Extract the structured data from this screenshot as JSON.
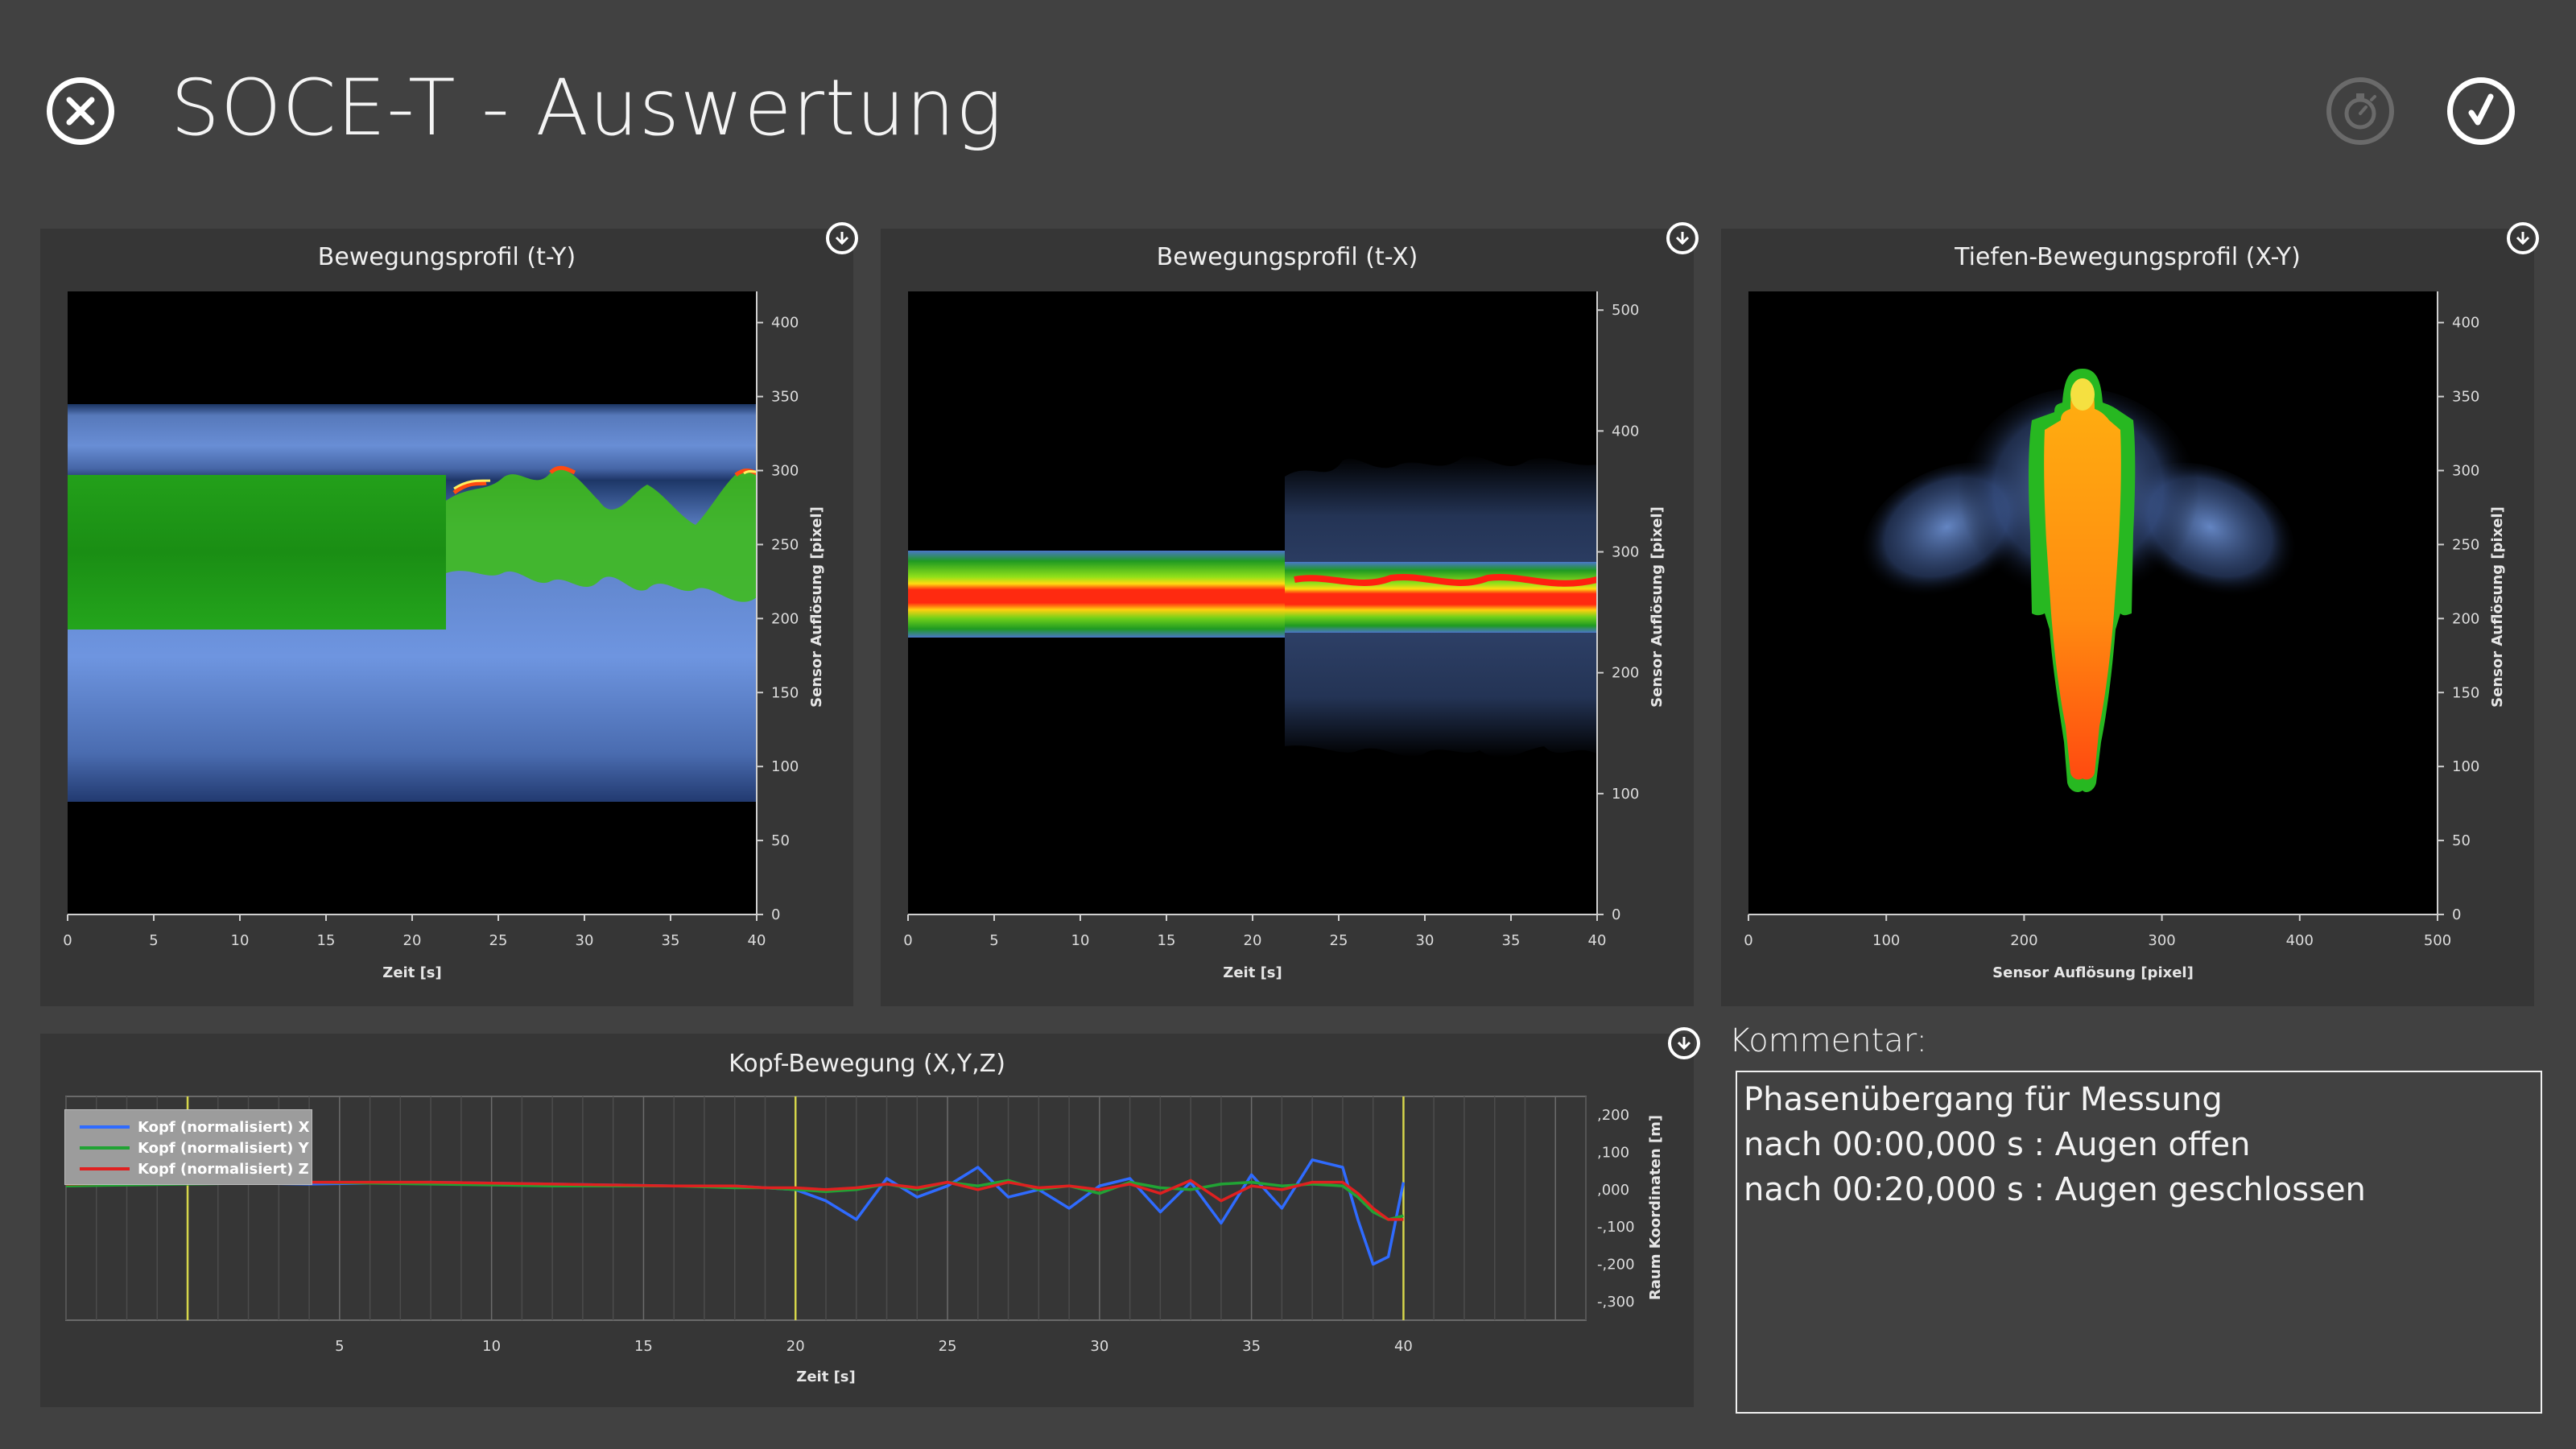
{
  "header": {
    "title": "SOCE-T - Auswertung",
    "close_icon": "close-circle-icon",
    "timer_icon": "stopwatch-icon",
    "confirm_icon": "checkmark-circle-icon"
  },
  "colors": {
    "background": "#414141",
    "panel": "#363636",
    "series_x": "#2f6bff",
    "series_y": "#21a334",
    "series_z": "#e02020",
    "marker": "#d6d64a"
  },
  "panels": {
    "ty": {
      "title": "Bewegungsprofil (t-Y)",
      "xlabel": "Zeit [s]",
      "ylabel": "Sensor Auflösung [pixel]",
      "xticks": [
        "0",
        "5",
        "10",
        "15",
        "20",
        "25",
        "30",
        "35",
        "40"
      ],
      "yticks": [
        "0",
        "50",
        "100",
        "150",
        "200",
        "250",
        "300",
        "350",
        "400"
      ],
      "download_icon": "download-icon"
    },
    "tx": {
      "title": "Bewegungsprofil (t-X)",
      "xlabel": "Zeit [s]",
      "ylabel": "Sensor Auflösung [pixel]",
      "xticks": [
        "0",
        "5",
        "10",
        "15",
        "20",
        "25",
        "30",
        "35",
        "40"
      ],
      "yticks": [
        "0",
        "100",
        "200",
        "300",
        "400",
        "500"
      ],
      "download_icon": "download-icon"
    },
    "xy": {
      "title": "Tiefen-Bewegungsprofil (X-Y)",
      "xlabel": "Sensor Auflösung [pixel]",
      "ylabel": "Sensor Auflösung [pixel]",
      "xticks": [
        "0",
        "100",
        "200",
        "300",
        "400",
        "500"
      ],
      "yticks": [
        "0",
        "50",
        "100",
        "150",
        "200",
        "250",
        "300",
        "350",
        "400"
      ],
      "download_icon": "download-icon"
    }
  },
  "chart_data": {
    "type": "line",
    "title": "Kopf-Bewegung (X,Y,Z)",
    "xlabel": "Zeit [s]",
    "ylabel": "Raum Koordinaten [m]",
    "xticks": [
      "5",
      "10",
      "15",
      "20",
      "25",
      "30",
      "35",
      "40"
    ],
    "yticks": [
      ",200",
      ",100",
      ",000",
      "-,100",
      "-,200",
      "-,300"
    ],
    "xlim": [
      -4,
      46
    ],
    "ylim": [
      -0.35,
      0.25
    ],
    "markers_x": [
      0,
      20,
      40
    ],
    "legend_position": "top-left",
    "x": [
      -4,
      0,
      4,
      8,
      12,
      16,
      18,
      19,
      20,
      21,
      22,
      23,
      24,
      25,
      26,
      27,
      28,
      29,
      30,
      31,
      32,
      33,
      34,
      35,
      36,
      37,
      38,
      38.5,
      39,
      39.5,
      40
    ],
    "series": [
      {
        "name": "Kopf (normalisiert) X",
        "values": [
          0.02,
          0.02,
          0.015,
          0.02,
          0.015,
          0.01,
          0.01,
          0.005,
          0.0,
          -0.03,
          -0.08,
          0.03,
          -0.02,
          0.01,
          0.06,
          -0.02,
          0.0,
          -0.05,
          0.01,
          0.03,
          -0.06,
          0.02,
          -0.09,
          0.04,
          -0.05,
          0.08,
          0.06,
          -0.08,
          -0.2,
          -0.18,
          0.02
        ]
      },
      {
        "name": "Kopf (normalisiert) Y",
        "values": [
          0.01,
          0.015,
          0.02,
          0.015,
          0.01,
          0.01,
          0.005,
          0.005,
          0.0,
          -0.005,
          0.0,
          0.015,
          0.0,
          0.02,
          0.01,
          0.025,
          0.0,
          0.01,
          -0.01,
          0.02,
          0.005,
          0.0,
          0.015,
          0.02,
          0.01,
          0.015,
          0.01,
          -0.02,
          -0.06,
          -0.08,
          -0.07
        ]
      },
      {
        "name": "Kopf (normalisiert) Z",
        "values": [
          0.015,
          0.02,
          0.02,
          0.02,
          0.015,
          0.01,
          0.01,
          0.005,
          0.005,
          0.0,
          0.005,
          0.015,
          0.005,
          0.02,
          0.0,
          0.02,
          0.005,
          0.01,
          0.0,
          0.015,
          -0.01,
          0.025,
          -0.03,
          0.01,
          0.0,
          0.02,
          0.02,
          -0.01,
          -0.05,
          -0.08,
          -0.08
        ]
      }
    ]
  },
  "comment": {
    "label": "Kommentar:",
    "lines": [
      "Phasenübergang für Messung",
      "nach 00:00,000 s : Augen offen",
      "nach 00:20,000 s : Augen geschlossen"
    ]
  }
}
